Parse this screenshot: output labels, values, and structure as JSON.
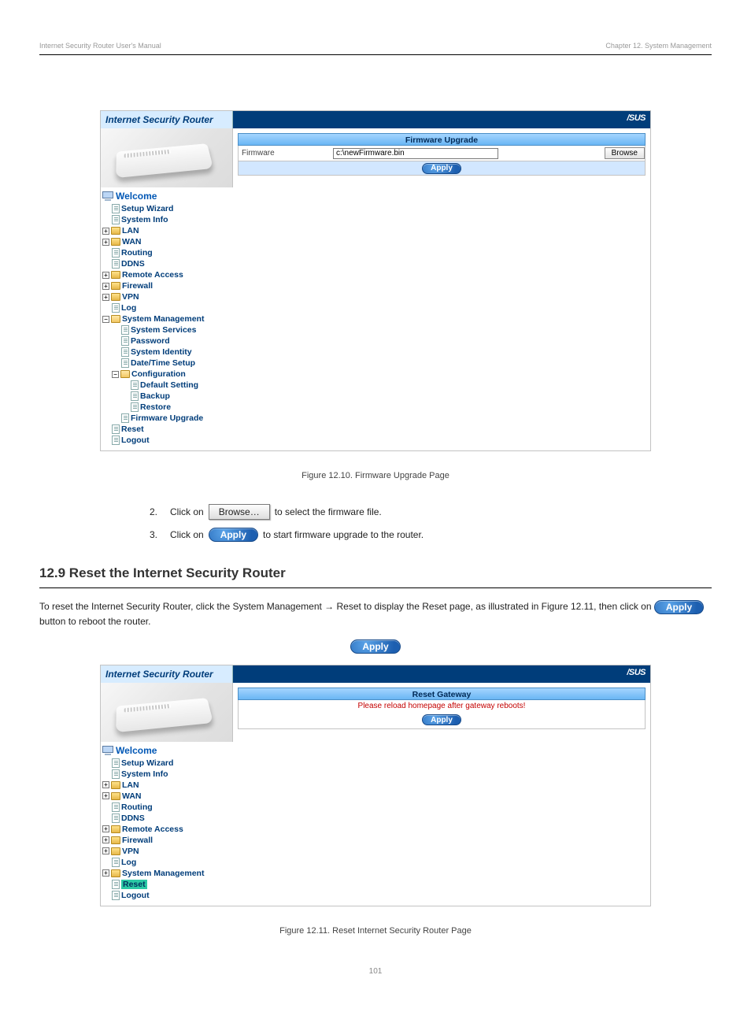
{
  "header": {
    "left": "Internet Security Router User's Manual",
    "right": "Chapter 12. System Management"
  },
  "router": {
    "title": "Internet Security Router",
    "logo": "/SUS"
  },
  "firmware": {
    "panel_title": "Firmware Upgrade",
    "label": "Firmware",
    "value": "c:\\newFirmware.bin",
    "browse": "Browse",
    "apply": "Apply"
  },
  "tree": {
    "welcome": "Welcome",
    "setup_wizard": "Setup Wizard",
    "system_info": "System Info",
    "lan": "LAN",
    "wan": "WAN",
    "routing": "Routing",
    "ddns": "DDNS",
    "remote_access": "Remote Access",
    "firewall": "Firewall",
    "vpn": "VPN",
    "log": "Log",
    "system_management": "System Management",
    "system_services": "System Services",
    "password": "Password",
    "system_identity": "System Identity",
    "datetime": "Date/Time Setup",
    "configuration": "Configuration",
    "default_setting": "Default Setting",
    "backup": "Backup",
    "restore": "Restore",
    "firmware_upgrade": "Firmware Upgrade",
    "reset": "Reset",
    "logout": "Logout"
  },
  "figure1": "Figure 12.10. Firmware Upgrade Page",
  "steps": {
    "s2_pre": "Click on",
    "s2_btn": "Browse…",
    "s2_post": "to select the firmware file.",
    "s3_pre": "Click on",
    "s3_btn": "Apply",
    "s3_post": "to start firmware upgrade to the router."
  },
  "section12_9": {
    "heading": "12.9 Reset the Internet Security Router",
    "body_pre": "To reset the Internet Security Router, click the System Management → Reset to display the Reset page, as illustrated in Figure 12.11, then click on ",
    "body_post": " button to reboot the router."
  },
  "reset": {
    "panel_title": "Reset Gateway",
    "message": "Please reload homepage after gateway reboots!",
    "apply": "Apply"
  },
  "figure2": "Figure 12.11. Reset Internet Security Router Page",
  "page_number": "101"
}
